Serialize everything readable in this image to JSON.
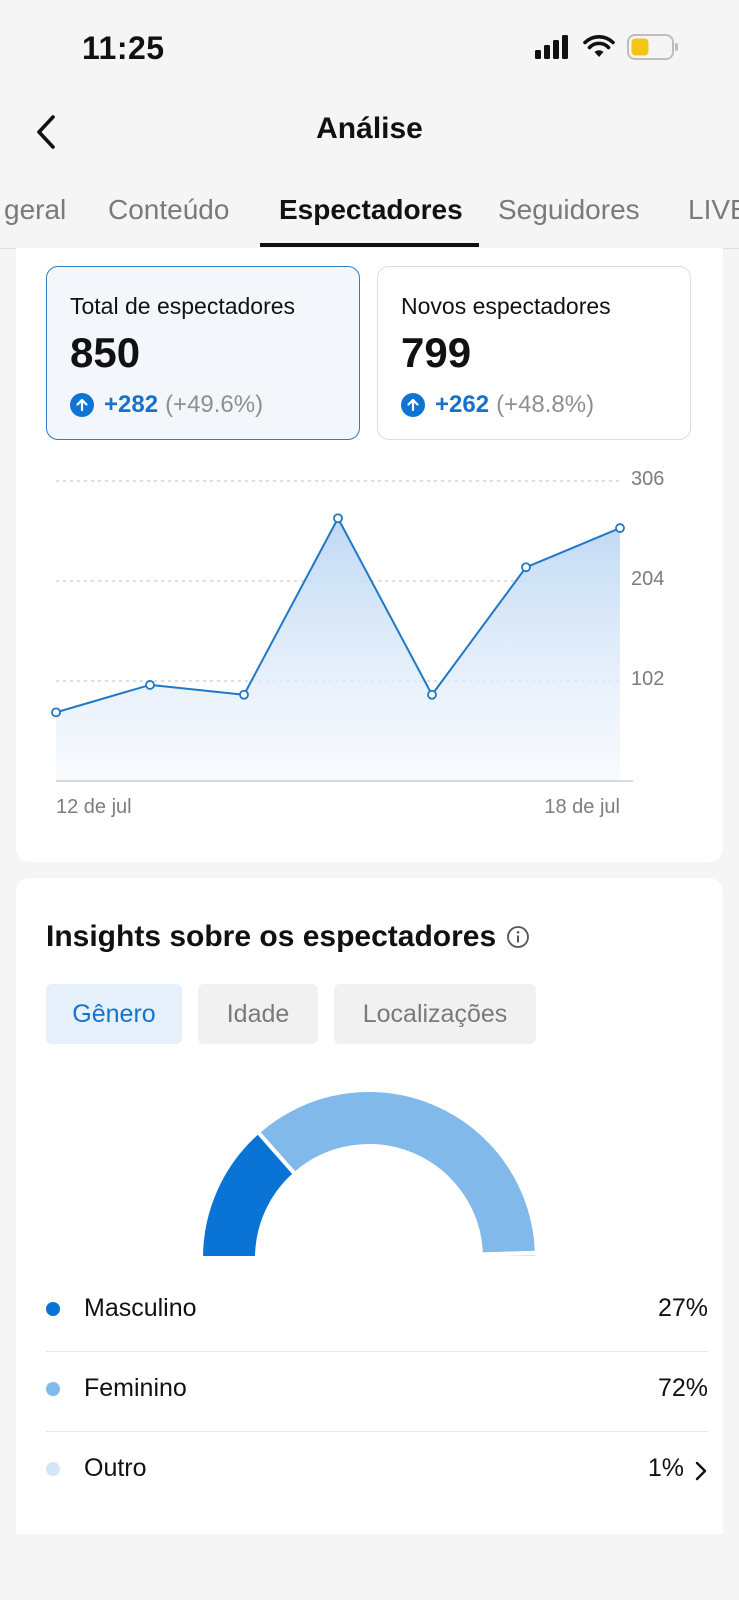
{
  "status_bar": {
    "time": "11:25"
  },
  "header": {
    "title": "Análise"
  },
  "tabs": [
    {
      "label": "geral"
    },
    {
      "label": "Conteúdo"
    },
    {
      "label": "Espectadores"
    },
    {
      "label": "Seguidores"
    },
    {
      "label": "LIVE"
    }
  ],
  "metrics": [
    {
      "label": "Total de espectadores",
      "value": "850",
      "change": "+282",
      "change_pct": "(+49.6%)"
    },
    {
      "label": "Novos espectadores",
      "value": "799",
      "change": "+262",
      "change_pct": "(+48.8%)"
    }
  ],
  "colors": {
    "accent": "#0d74d4",
    "line": "#1f78c8",
    "male": "#0a73d6",
    "female": "#82b9eb",
    "other": "#d3e5f7"
  },
  "chart_data": {
    "type": "area",
    "x_labels": [
      "12 de jul",
      "18 de jul"
    ],
    "x": [
      "12 de jul",
      "13 de jul",
      "14 de jul",
      "15 de jul",
      "16 de jul",
      "17 de jul",
      "18 de jul"
    ],
    "y": [
      70,
      98,
      88,
      268,
      88,
      218,
      258
    ],
    "yticks": [
      "306",
      "204",
      "102"
    ],
    "ytick_values": [
      306,
      204,
      102
    ],
    "ylim": [
      0,
      306
    ]
  },
  "insights": {
    "title": "Insights sobre os espectadores",
    "chips": [
      "Gênero",
      "Idade",
      "Localizações"
    ],
    "gender_data": [
      {
        "label": "Masculino",
        "percent": "27%",
        "value": 27
      },
      {
        "label": "Feminino",
        "percent": "72%",
        "value": 72
      },
      {
        "label": "Outro",
        "percent": "1%",
        "value": 1
      }
    ]
  }
}
